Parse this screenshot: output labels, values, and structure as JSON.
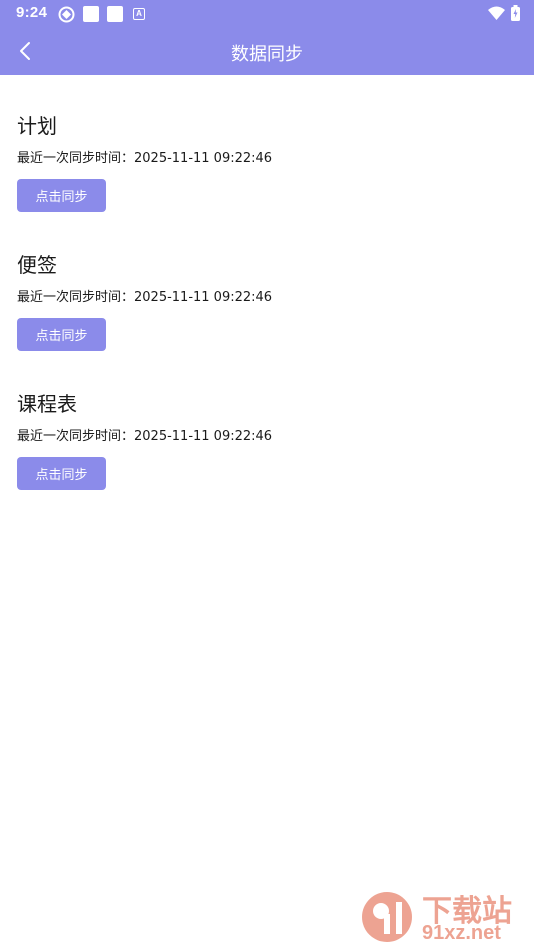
{
  "status_bar": {
    "time": "9:24",
    "a_badge": "A"
  },
  "app_bar": {
    "title": "数据同步"
  },
  "sections": [
    {
      "title": "计划",
      "sync_text": "最近一次同步时间：2025-11-11 09:22:46",
      "button_label": "点击同步"
    },
    {
      "title": "便签",
      "sync_text": "最近一次同步时间：2025-11-11 09:22:46",
      "button_label": "点击同步"
    },
    {
      "title": "课程表",
      "sync_text": "最近一次同步时间：2025-11-11 09:22:46",
      "button_label": "点击同步"
    }
  ],
  "watermark": {
    "brand": "下载站",
    "domain": "91xz.net"
  },
  "colors": {
    "accent": "#8b8bea",
    "background": "#ffffff",
    "text": "#1a1a1a",
    "watermark": "#e0593a"
  },
  "icons": {
    "back": "chevron-left-icon",
    "wifi": "wifi-icon",
    "battery": "battery-charging-icon",
    "sync_status": "sync-status-icon"
  }
}
